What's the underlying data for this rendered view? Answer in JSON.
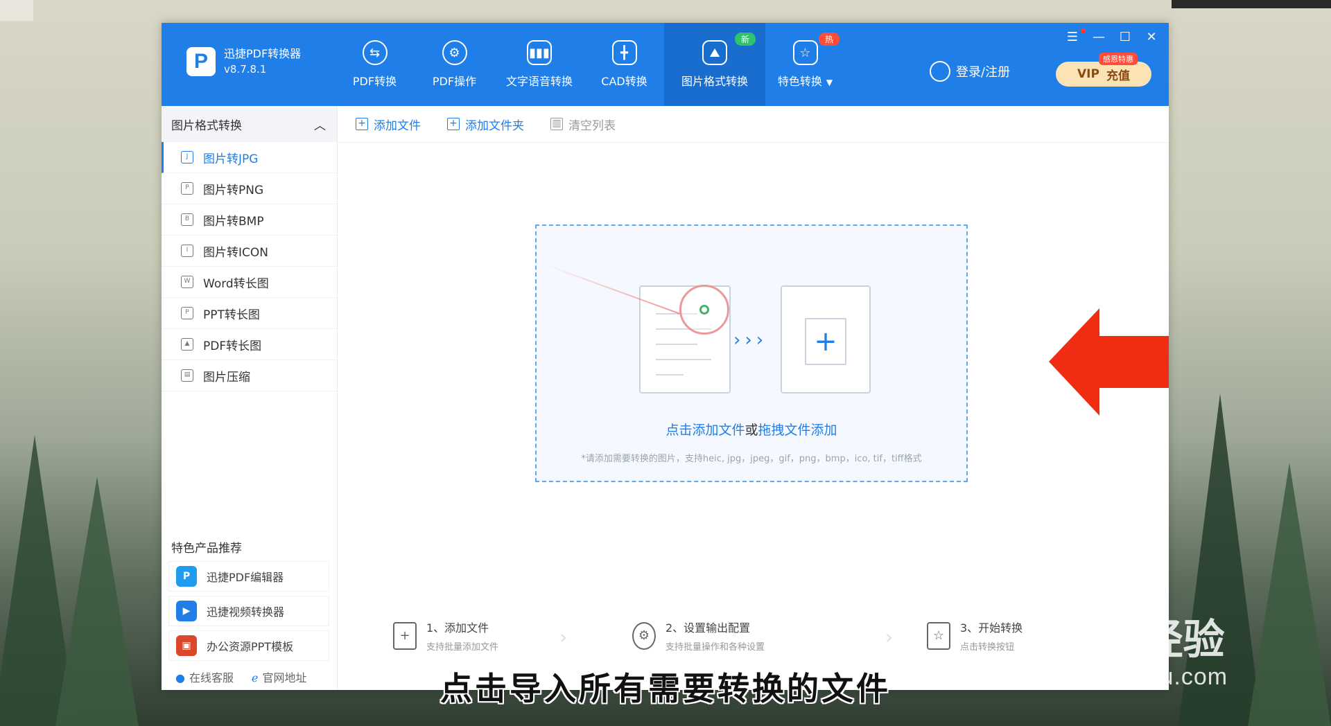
{
  "app": {
    "name": "迅捷PDF转换器",
    "version": "v8.7.8.1",
    "logo_letter": "P"
  },
  "nav": {
    "items": [
      {
        "label": "PDF转换",
        "icon": "swap-icon"
      },
      {
        "label": "PDF操作",
        "icon": "gear-icon"
      },
      {
        "label": "文字语音转换",
        "icon": "waveform-icon"
      },
      {
        "label": "CAD转换",
        "icon": "cad-icon"
      },
      {
        "label": "图片格式转换",
        "icon": "image-icon",
        "badge": "新",
        "active": true
      },
      {
        "label": "特色转换",
        "icon": "star-refresh-icon",
        "badge": "热"
      }
    ]
  },
  "header": {
    "login": "登录/注册",
    "vip_label": "VIP",
    "vip_action": "充值",
    "vip_tag": "感恩特惠"
  },
  "window_controls": {
    "menu": "☰",
    "minimize": "—",
    "maximize": "☐",
    "close": "✕"
  },
  "sidebar": {
    "title": "图片格式转换",
    "items": [
      {
        "label": "图片转JPG",
        "active": true
      },
      {
        "label": "图片转PNG"
      },
      {
        "label": "图片转BMP"
      },
      {
        "label": "图片转ICON"
      },
      {
        "label": "Word转长图"
      },
      {
        "label": "PPT转长图"
      },
      {
        "label": "PDF转长图"
      },
      {
        "label": "图片压缩"
      }
    ],
    "featured_title": "特色产品推荐",
    "featured": [
      {
        "label": "迅捷PDF编辑器",
        "icon": "pdf-editor-icon",
        "color": "#1f9cf0"
      },
      {
        "label": "迅捷视频转换器",
        "icon": "video-converter-icon",
        "color": "#1f7ee8"
      },
      {
        "label": "办公资源PPT模板",
        "icon": "ppt-template-icon",
        "color": "#d9482b"
      }
    ],
    "footer": {
      "service": "在线客服",
      "website": "官网地址"
    }
  },
  "toolbar": {
    "add_file": "添加文件",
    "add_folder": "添加文件夹",
    "clear_list": "清空列表"
  },
  "dropzone": {
    "click_add": "点击添加文件",
    "or": "或",
    "drag_add": "拖拽文件添加",
    "hint": "*请添加需要转换的图片，支持heic, jpg，jpeg，gif，png，bmp，ico, tif，tiff格式"
  },
  "steps": [
    {
      "title": "1、添加文件",
      "sub": "支持批量添加文件"
    },
    {
      "title": "2、设置输出配置",
      "sub": "支持批量操作和各种设置"
    },
    {
      "title": "3、开始转换",
      "sub": "点击转换按钮"
    }
  ],
  "caption": "点击导入所有需要转换的文件",
  "watermark": {
    "brand": "Baidu经验",
    "url": "jingyan.baidu.com"
  },
  "colors": {
    "accent": "#1f7ee8",
    "arrow": "#f02c12",
    "vip_bg": "#fbe3b6"
  }
}
